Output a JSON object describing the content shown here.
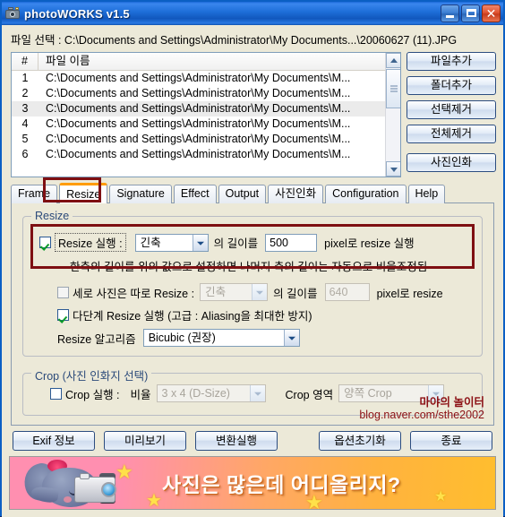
{
  "window": {
    "title": "photoWORKS v1.5",
    "icon": "camera-icon",
    "minimize_label": "Minimize",
    "maximize_label": "Maximize",
    "close_label": "Close"
  },
  "path_bar": {
    "text": "파일 선택 : C:\\Documents and Settings\\Administrator\\My Documents...\\20060627 (11).JPG"
  },
  "file_list": {
    "columns": [
      "#",
      "파일 이름"
    ],
    "rows": [
      {
        "num": "1",
        "name": "C:\\Documents and Settings\\Administrator\\My Documents\\M..."
      },
      {
        "num": "2",
        "name": "C:\\Documents and Settings\\Administrator\\My Documents\\M..."
      },
      {
        "num": "3",
        "name": "C:\\Documents and Settings\\Administrator\\My Documents\\M..."
      },
      {
        "num": "4",
        "name": "C:\\Documents and Settings\\Administrator\\My Documents\\M..."
      },
      {
        "num": "5",
        "name": "C:\\Documents and Settings\\Administrator\\My Documents\\M..."
      },
      {
        "num": "6",
        "name": "C:\\Documents and Settings\\Administrator\\My Documents\\M..."
      }
    ],
    "selected_row_index": 2
  },
  "side_buttons": [
    {
      "label": "파일추가"
    },
    {
      "label": "폴더추가"
    },
    {
      "label": "선택제거"
    },
    {
      "label": "전체제거"
    },
    {
      "label": "사진인화"
    }
  ],
  "tabs": [
    {
      "label": "Frame",
      "active": false
    },
    {
      "label": "Resize",
      "active": true
    },
    {
      "label": "Signature",
      "active": false
    },
    {
      "label": "Effect",
      "active": false
    },
    {
      "label": "Output",
      "active": false
    },
    {
      "label": "사진인화",
      "active": false
    },
    {
      "label": "Configuration",
      "active": false
    },
    {
      "label": "Help",
      "active": false
    }
  ],
  "resize_group": {
    "legend": "Resize",
    "enable_checkbox": {
      "label": "Resize 실행 :",
      "checked": true
    },
    "axis_combo": {
      "value": "긴축",
      "enabled": true
    },
    "length_label_1": "의 길이를",
    "length_value": "500",
    "length_suffix": "pixel로 resize 실행",
    "note": "한축의 길이를 위의 값으로 설정하면 나머지 축의 길이는 자동으로 비율조정됨",
    "vertical_checkbox": {
      "label": "세로 사진은 따로 Resize :",
      "checked": false
    },
    "vertical_combo": {
      "value": "긴축",
      "enabled": false
    },
    "vertical_length_label": "의 길이를",
    "vertical_length_value": "640",
    "vertical_suffix": "pixel로 resize",
    "multistep_checkbox": {
      "label": "다단계 Resize 실행 (고급 : Aliasing을 최대한 방지)",
      "checked": true
    },
    "algorithm_label": "Resize 알고리즘",
    "algorithm_combo": {
      "value": "Bicubic (권장)",
      "enabled": true
    }
  },
  "crop_group": {
    "legend": "Crop (사진 인화지 선택)",
    "enable_checkbox": {
      "label": "Crop 실행 :",
      "checked": false
    },
    "ratio_label": "비율",
    "ratio_combo": {
      "value": "3 x 4 (D-Size)",
      "enabled": false
    },
    "area_label": "Crop 영역",
    "area_combo": {
      "value": "양쪽 Crop",
      "enabled": false
    }
  },
  "watermark": {
    "line1": "마야의 놀이터",
    "line2": "blog.naver.com/sthe2002",
    "color": "#8c1014"
  },
  "bottom_buttons_left": [
    {
      "label": "Exif 정보"
    },
    {
      "label": "미리보기"
    },
    {
      "label": "변환실행"
    }
  ],
  "bottom_buttons_right": [
    {
      "label": "옵션초기화"
    },
    {
      "label": "종료"
    }
  ],
  "banner": {
    "text": "사진은 많은데 어디올리지?",
    "character": "elephant-with-camera",
    "gradient_start": "#ff8fb0",
    "gradient_end": "#ffbe2e"
  },
  "annotations": {
    "tab_highlight_color": "#7e0f12",
    "resize_row_highlight_color": "#7e0f12",
    "active_tab_accent": "#ff9c00"
  }
}
